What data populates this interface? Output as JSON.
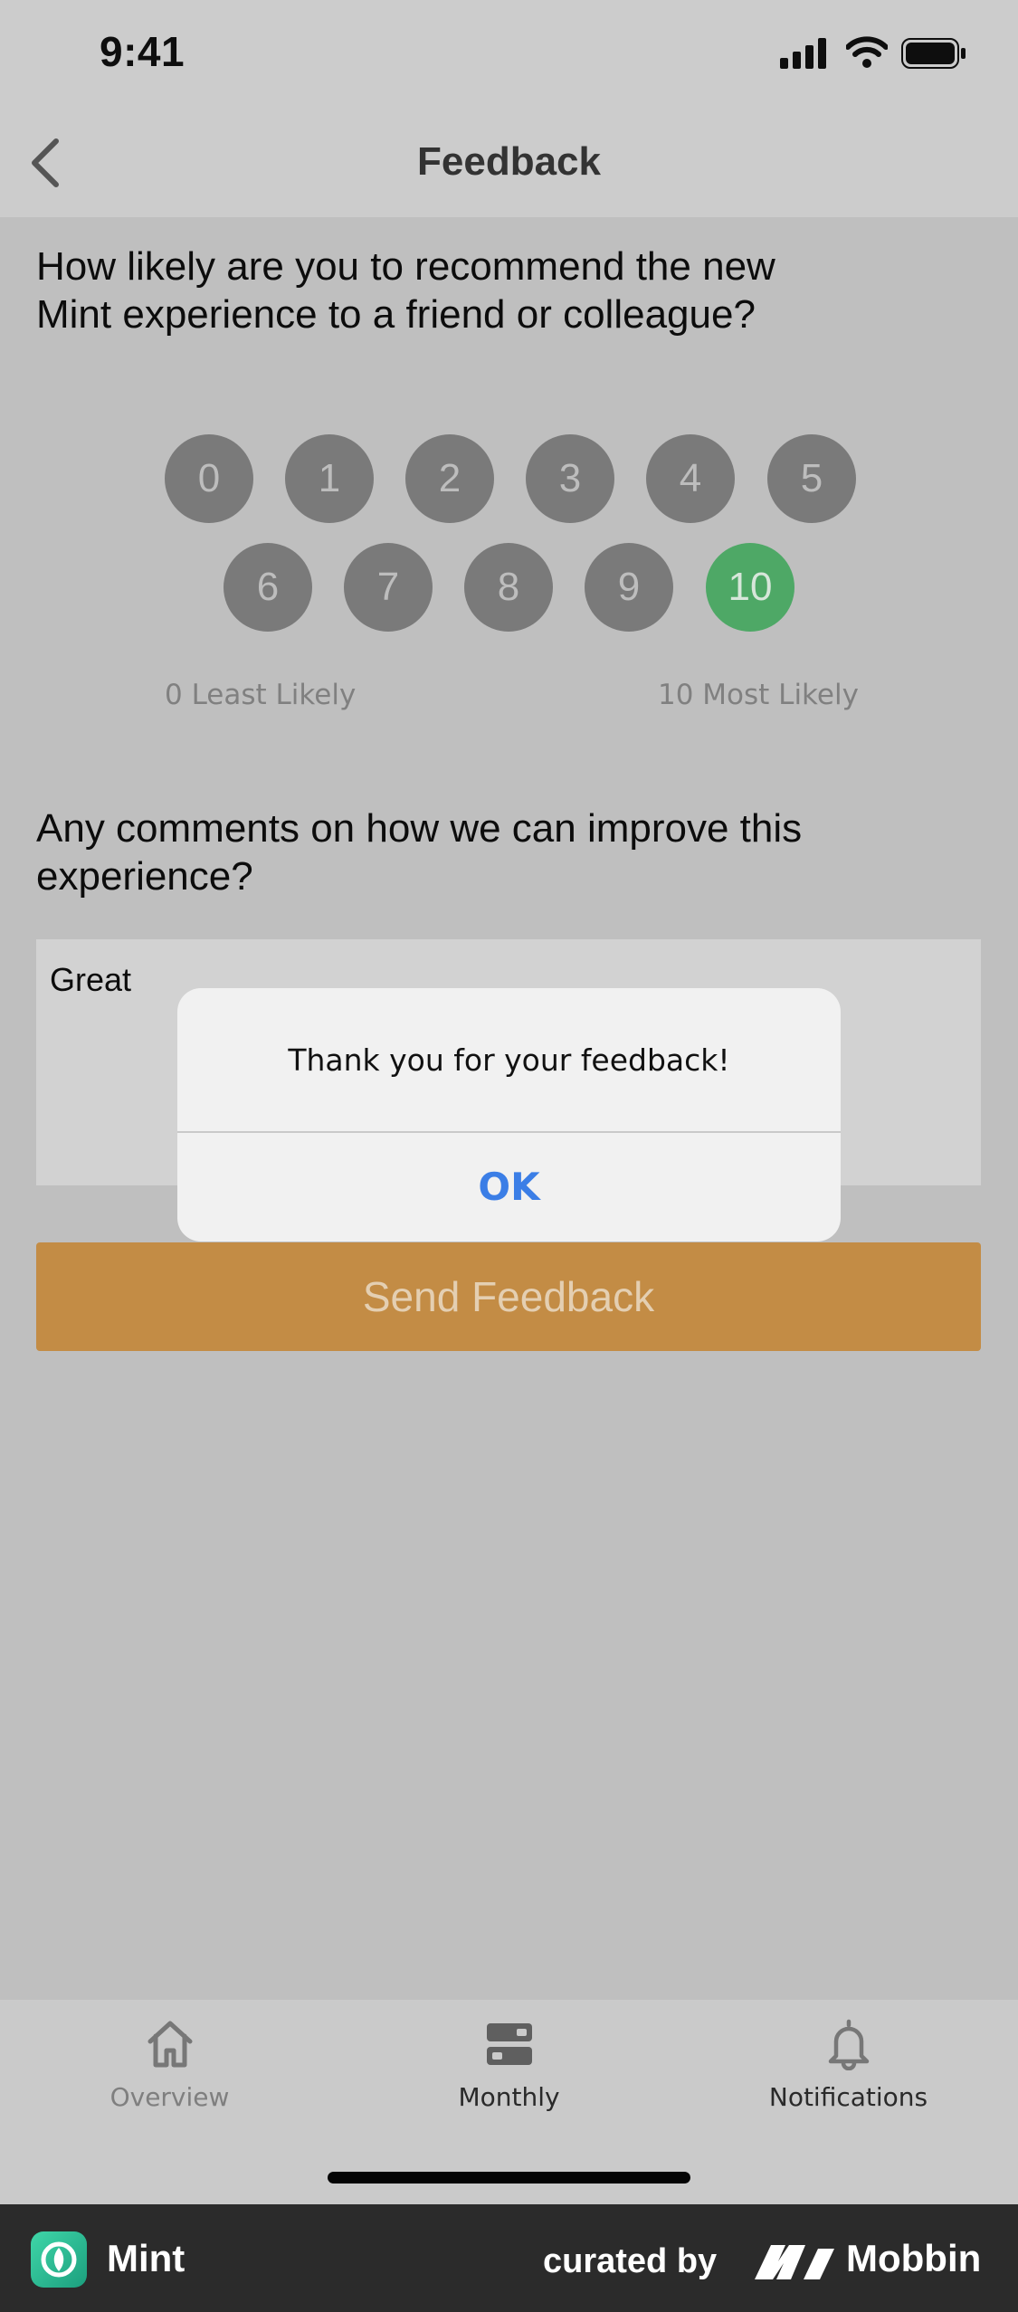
{
  "status_bar": {
    "time": "9:41"
  },
  "nav": {
    "title": "Feedback"
  },
  "question1": {
    "line1": "How likely are you to recommend the new",
    "line2": "Mint experience to a friend or colleague?"
  },
  "rating": {
    "row1": [
      "0",
      "1",
      "2",
      "3",
      "4",
      "5"
    ],
    "row2": [
      "6",
      "7",
      "8",
      "9",
      "10"
    ],
    "selected": "10",
    "min_label": "0 Least Likely",
    "max_label": "10 Most Likely"
  },
  "question2": {
    "line1": "Any comments on how we can improve this",
    "line2": "experience?"
  },
  "comment": {
    "value": "Great"
  },
  "send_button": {
    "label": "Send Feedback"
  },
  "alert": {
    "message": "Thank you for your feedback!",
    "ok_label": "OK"
  },
  "tabs": [
    {
      "label": "Overview",
      "icon": "home-icon",
      "active": false
    },
    {
      "label": "Monthly",
      "icon": "monthly-icon",
      "active": true
    },
    {
      "label": "Notifications",
      "icon": "bell-icon",
      "active": false
    }
  ],
  "footer": {
    "app_name": "Mint",
    "curated_by": "curated by",
    "brand": "Mobbin"
  },
  "colors": {
    "accent_orange": "#c38c45",
    "selected_green": "#4ea866",
    "alert_blue": "#3b7ee6"
  }
}
